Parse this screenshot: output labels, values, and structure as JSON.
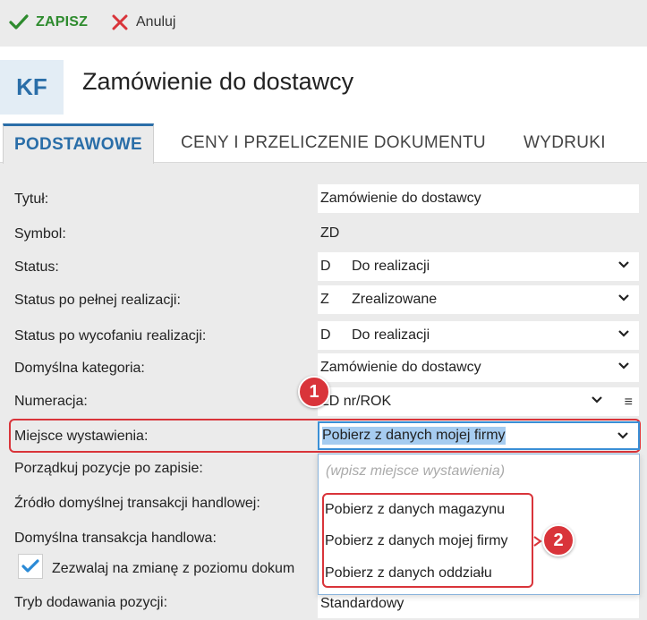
{
  "toolbar": {
    "save_label": "ZAPISZ",
    "cancel_label": "Anuluj"
  },
  "header": {
    "badge": "KF",
    "title": "Zamówienie do dostawcy"
  },
  "tabs": [
    {
      "label": "PODSTAWOWE",
      "active": true
    },
    {
      "label": "CENY I PRZELICZENIE DOKUMENTU",
      "active": false
    },
    {
      "label": "WYDRUKI",
      "active": false
    }
  ],
  "form": {
    "title": {
      "label": "Tytuł:",
      "value": "Zamówienie do dostawcy"
    },
    "symbol": {
      "label": "Symbol:",
      "value": "ZD"
    },
    "status": {
      "label": "Status:",
      "code": "D",
      "value": "Do realizacji"
    },
    "status_full": {
      "label": "Status po pełnej realizacji:",
      "code": "Z",
      "value": "Zrealizowane"
    },
    "status_revoke": {
      "label": "Status po wycofaniu realizacji:",
      "code": "D",
      "value": "Do realizacji"
    },
    "category": {
      "label": "Domyślna kategoria:",
      "value": "Zamówienie do dostawcy"
    },
    "numbering": {
      "label": "Numeracja:",
      "value": "ZD nr/ROK"
    },
    "place": {
      "label": "Miejsce wystawienia:",
      "value": "Pobierz z danych mojej firmy"
    },
    "order_items": {
      "label": "Porządkuj pozycje po zapisie:"
    },
    "source_trans": {
      "label": "Źródło domyślnej transakcji handlowej:"
    },
    "default_trans": {
      "label": "Domyślna transakcja handlowa:"
    },
    "allow_change": {
      "label": "Zezwalaj na zmianę z poziomu dokum",
      "checked": true
    },
    "add_mode": {
      "label": "Tryb dodawania pozycji:",
      "value": "Standardowy"
    }
  },
  "dropdown": {
    "placeholder": "(wpisz miejsce wystawienia)",
    "options": [
      "Pobierz z danych magazynu",
      "Pobierz z danych mojej firmy",
      "Pobierz z danych oddziału"
    ]
  },
  "annotations": {
    "badge_1": "1",
    "badge_2": "2"
  },
  "colors": {
    "accent": "#2a6ea8",
    "save_green": "#2e8b2e",
    "highlight_red": "#d9343a",
    "focus_blue": "#3a8fd6"
  },
  "icons": {
    "save": "checkmark-icon",
    "cancel": "x-icon",
    "select": "chevron-down-icon",
    "menu": "hamburger-icon"
  }
}
